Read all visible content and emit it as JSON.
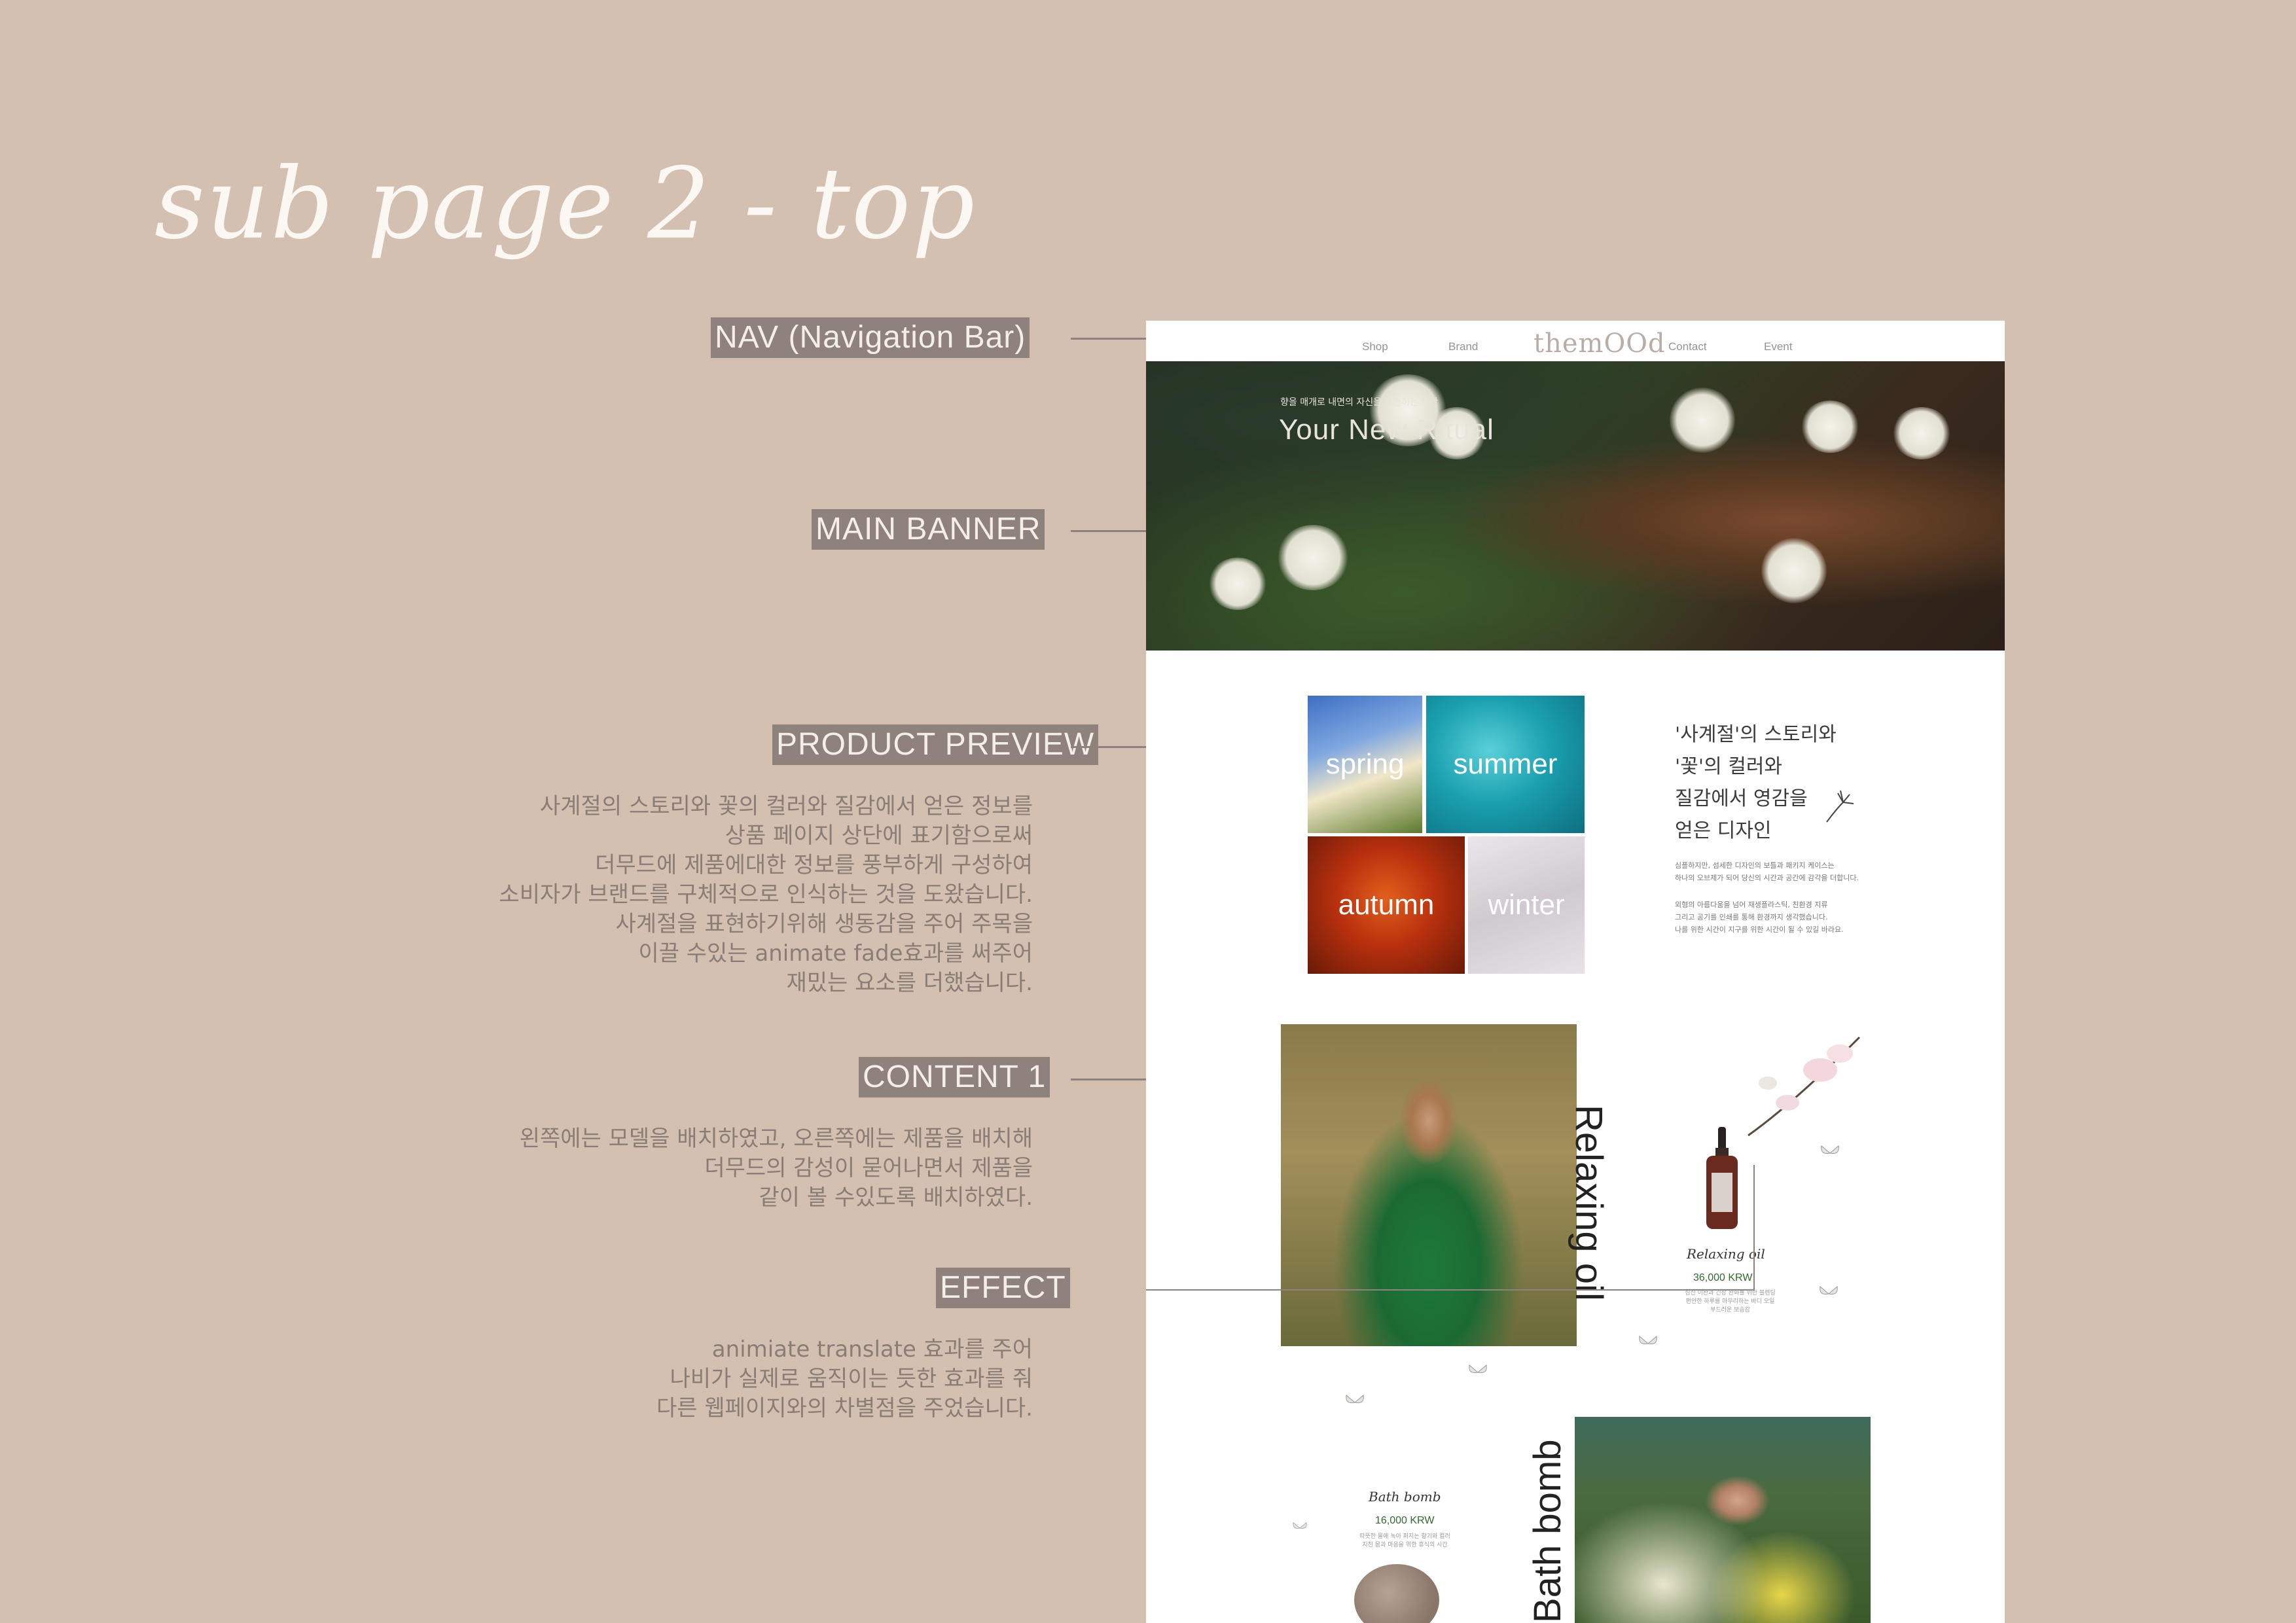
{
  "page_title": "sub page 2 - top",
  "annotations": [
    {
      "label": "NAV (Navigation Bar)",
      "lines": []
    },
    {
      "label": "MAIN BANNER",
      "lines": []
    },
    {
      "label": "PRODUCT PREVIEW",
      "lines": [
        "사계절의 스토리와 꽃의 컬러와 질감에서 얻은 정보를",
        "상품 페이지 상단에 표기함으로써",
        "더무드에 제품에대한 정보를 풍부하게 구성하여",
        "소비자가 브랜드를 구체적으로 인식하는 것을 도왔습니다.",
        "사계절을 표현하기위해 생동감을 주어 주목을",
        "이끌 수있는 animate fade효과를 써주어",
        "재밌는 요소를 더했습니다."
      ]
    },
    {
      "label": "CONTENT 1",
      "lines": [
        "왼쪽에는 모델을 배치하였고, 오른쪽에는 제품을 배치해",
        "더무드의 감성이 묻어나면서 제품을",
        "같이 볼 수있도록 배치하였다."
      ]
    },
    {
      "label": "EFFECT",
      "lines": [
        "animiate translate 효과를 주어",
        "나비가 실제로 움직이는 듯한 효과를 줘",
        "다른 웹페이지와의 차별점을 주었습니다."
      ]
    }
  ],
  "mockup": {
    "nav": {
      "items": [
        "Shop",
        "Brand",
        "Contact",
        "Event"
      ],
      "logo": "themOOd"
    },
    "banner": {
      "subtitle": "향을 매개로 내면의 자신을 표현하는 시간",
      "title": "Your New Ritual"
    },
    "seasons": [
      "spring",
      "summer",
      "autumn",
      "winter"
    ],
    "story": {
      "heading": [
        "'사계절'의 스토리와",
        "'꽃'의 컬러와",
        "질감에서 영감을",
        "얻은 디자인"
      ],
      "para1": [
        "심플하지만, 섬세한 디자인의 보틀과 패키지 케이스는",
        "하나의 오브제가 되어 당신의 시간과 공간에 감각을 더합니다."
      ],
      "para2": [
        "외형의 아름다움을 넘어 재생플라스틱, 친환경 지류",
        "그리고 공기를 인쇄를 통해 환경까지 생각했습니다.",
        "나를 위한 시간이 지구를 위한 시간이 될 수 있길 바라요."
      ]
    },
    "product1": {
      "vertical_title": "Relaxing oil",
      "name": "Relaxing oil",
      "price": "36,000 KRW",
      "desc": [
        "심신 이완과 긴장 완화를 위한 블렌딩",
        "편안한 하루를 마무리하는 바디 오일",
        "부드러운 보습감"
      ]
    },
    "product2": {
      "vertical_title": "Bath bomb",
      "name": "Bath bomb",
      "price": "16,000 KRW",
      "desc": [
        "따뜻한 물에 녹아 퍼지는 향기와 컬러",
        "지친 몸과 마음을 위한 휴식의 시간"
      ]
    },
    "colors": {
      "background": "#d3c0b1",
      "tag": "#8f817b",
      "price_green": "#2f6b2a"
    }
  }
}
